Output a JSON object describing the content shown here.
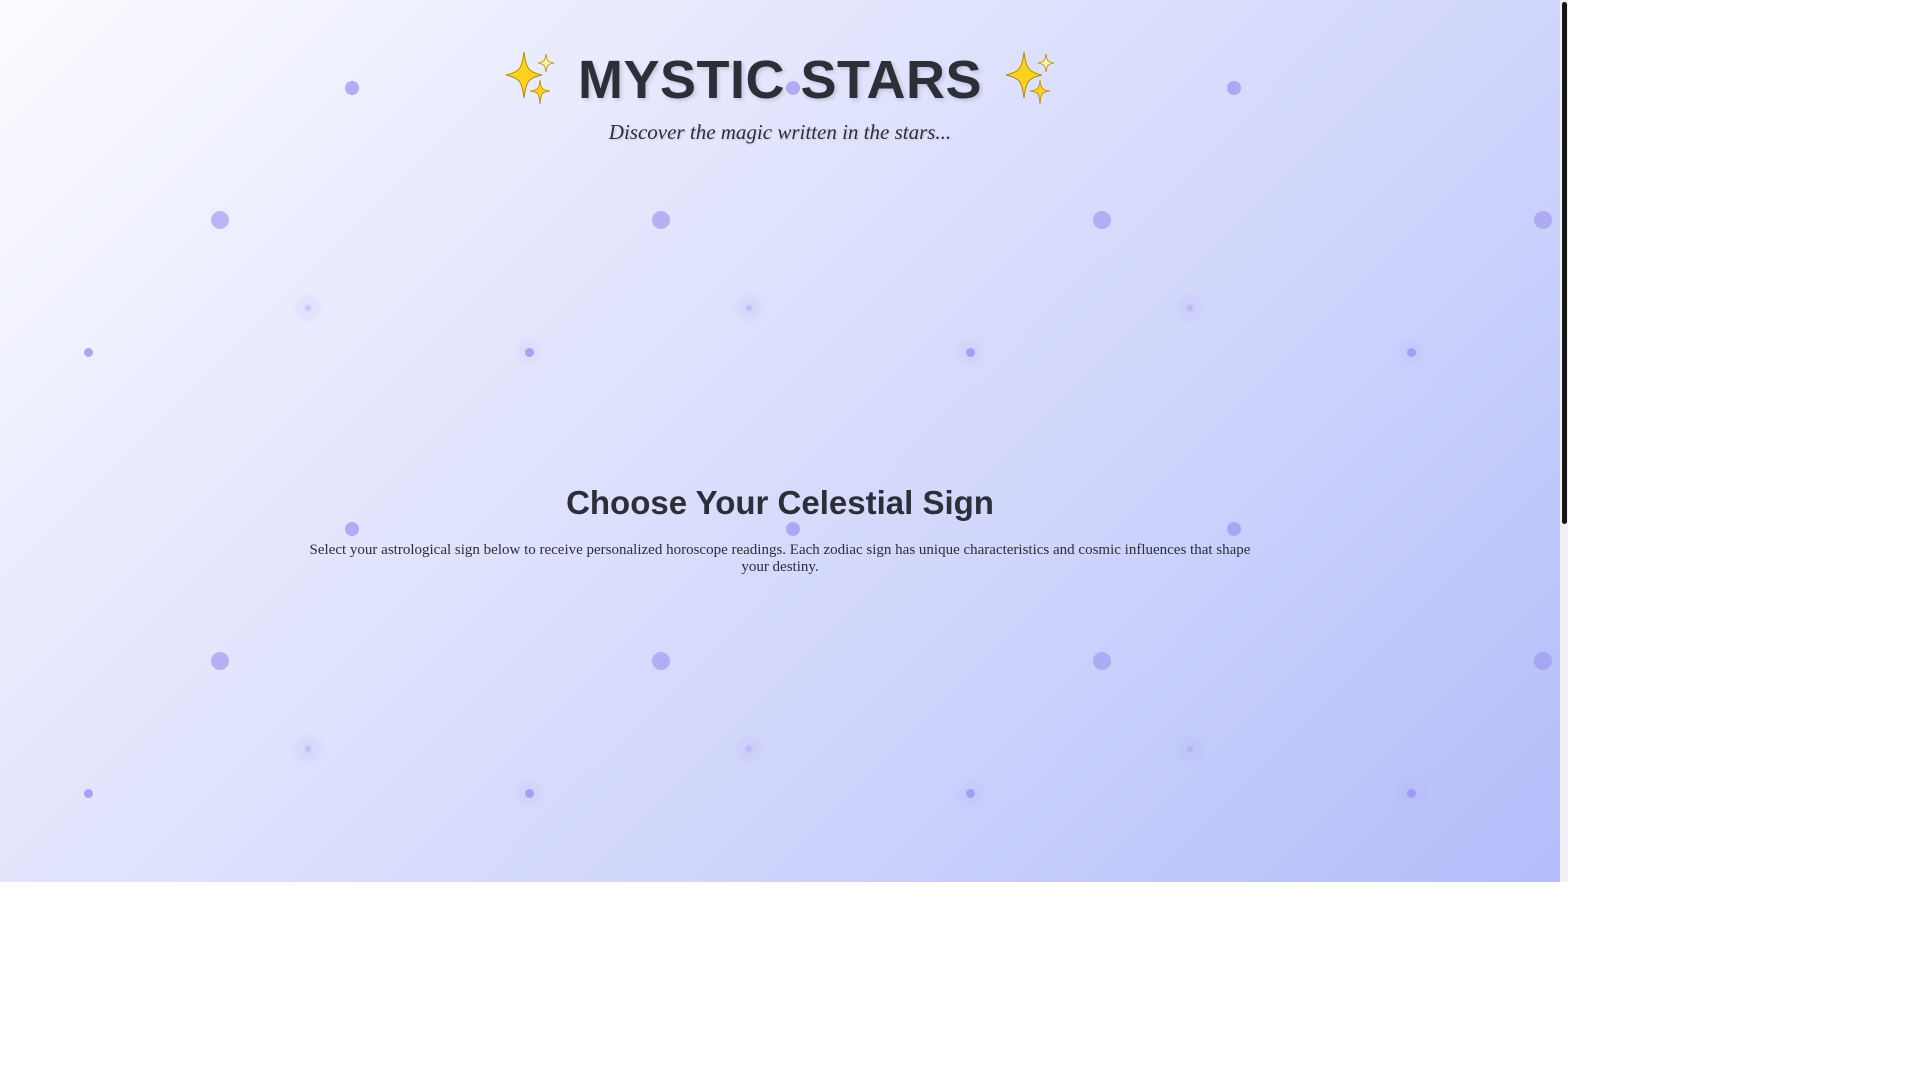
{
  "header": {
    "title": "MYSTIC STARS",
    "tagline": "Discover the magic written in the stars...",
    "left_icon": "sparkles-icon",
    "right_icon": "sparkles-icon"
  },
  "section": {
    "title": "Choose Your Celestial Sign",
    "description": "Select your astrological sign below to receive personalized horoscope readings. Each zodiac sign has unique characteristics and cosmic influences that shape your destiny."
  },
  "colors": {
    "background_start": "#fbfbff",
    "background_end": "#b3bdfa",
    "star_dot": "#9d97f0",
    "text": "#2b2f38",
    "sparkle": "#ffd21f"
  }
}
